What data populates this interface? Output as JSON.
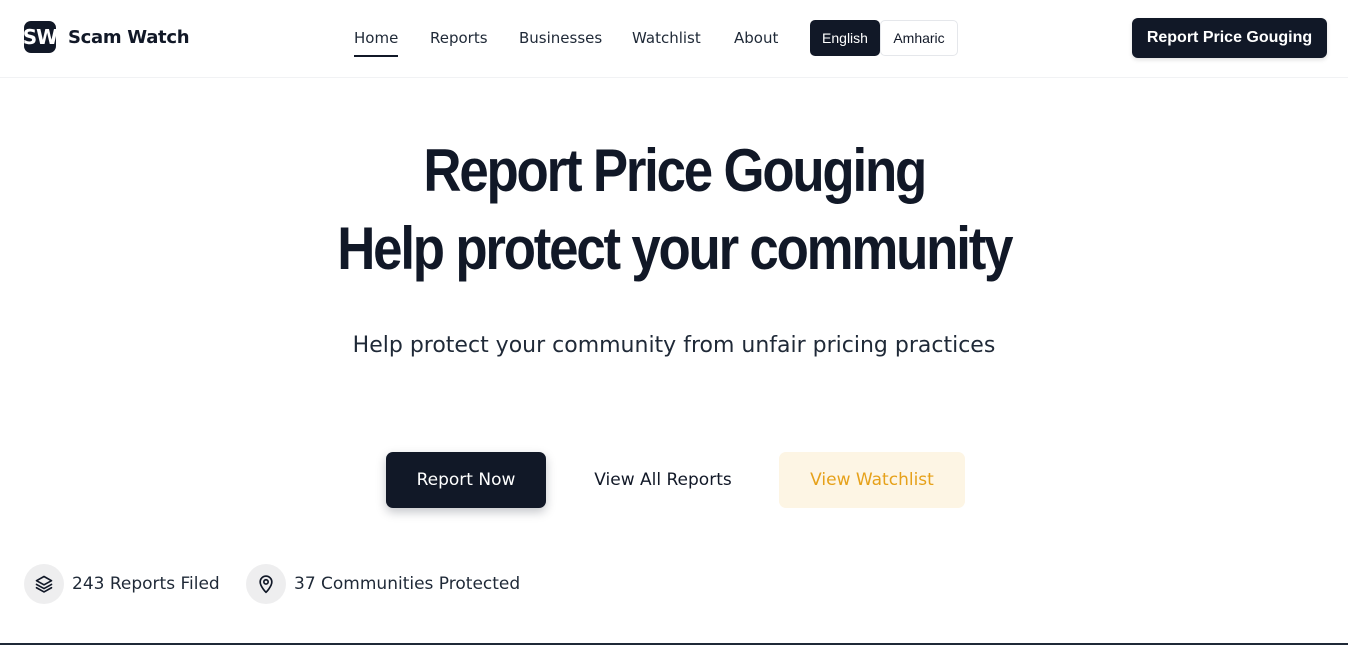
{
  "brand": {
    "logo_text": "SW",
    "name": "Scam Watch"
  },
  "nav": {
    "items": [
      {
        "label": "Home",
        "active": true
      },
      {
        "label": "Reports",
        "active": false
      },
      {
        "label": "Businesses",
        "active": false
      },
      {
        "label": "Watchlist",
        "active": false
      },
      {
        "label": "About",
        "active": false
      }
    ]
  },
  "language": {
    "options": [
      "English",
      "Amharic"
    ],
    "selected": "English"
  },
  "header_cta": {
    "label": "Report Price Gouging"
  },
  "hero": {
    "title_line1": "Report Price Gouging",
    "title_line2": "Help protect your community",
    "subtitle": "Help protect your community from unfair pricing practices"
  },
  "actions": {
    "report_now": "Report Now",
    "view_all_reports": "View All Reports",
    "view_watchlist": "View Watchlist"
  },
  "stats": {
    "reports": {
      "label": "243 Reports Filed",
      "icon": "layers-icon"
    },
    "communities": {
      "label": "37 Communities Protected",
      "icon": "map-pin-icon"
    }
  },
  "colors": {
    "primary": "#111827",
    "accent_amber": "#e6a11a",
    "amber_bg": "#fdf5e4",
    "icon_bg": "#eeeeef"
  }
}
